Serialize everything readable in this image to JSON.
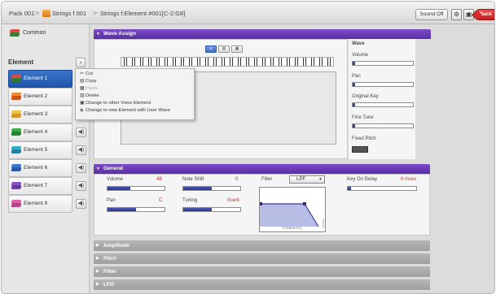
{
  "topbar": {
    "crumbs": [
      "Pack 001",
      "Strings f 001",
      "Strings f:Element #001[C-2:G8]"
    ],
    "separator": ">",
    "sound_off": "Sound Off",
    "back": "Back"
  },
  "sidebar": {
    "common": "Common",
    "element_header": "Element",
    "elements": [
      {
        "label": "Element 1",
        "selected": true,
        "c1": "#e04848",
        "c2": "#2c7a2a"
      },
      {
        "label": "Element 2",
        "c1": "#f08a30",
        "c2": "#c84b0a"
      },
      {
        "label": "Element 3",
        "c1": "#f0c040",
        "c2": "#d09020"
      },
      {
        "label": "Element 4",
        "c1": "#38b048",
        "c2": "#1e7a2a"
      },
      {
        "label": "Element 5",
        "c1": "#30b0c8",
        "c2": "#1b7c98"
      },
      {
        "label": "Element 6",
        "c1": "#3878d0",
        "c2": "#2050a8"
      },
      {
        "label": "Element 7",
        "c1": "#8a50c8",
        "c2": "#6030a0"
      },
      {
        "label": "Element 8",
        "c1": "#e060a8",
        "c2": "#b03a80"
      }
    ]
  },
  "context_menu": {
    "items": [
      {
        "label": "Cut",
        "icon": "✂"
      },
      {
        "label": "Copy",
        "icon": "▤"
      },
      {
        "label": "Paste",
        "icon": "▦",
        "disabled": true
      },
      {
        "label": "Delete",
        "icon": "▥"
      },
      {
        "label": "Change to other Voice Element",
        "icon": "▣"
      },
      {
        "label": "Change to new Element with User Wave",
        "icon": "◈"
      }
    ]
  },
  "wave_assign": {
    "title": "Wave Assign",
    "side": {
      "title": "Wave",
      "volume": "Volume",
      "pan": "Pan",
      "original_key": "Original Key",
      "fine_tune": "Fine Tune",
      "fixed_pitch": "Fixed Pitch"
    }
  },
  "general": {
    "title": "General",
    "volume_label": "Volume",
    "volume_value": "48",
    "pan_label": "Pan",
    "pan_value": "C",
    "note_shift_label": "Note Shift",
    "note_shift_value": "0",
    "tuning_label": "Tuning",
    "tuning_value": "0cent",
    "filter_label": "Filter",
    "filter_value": "LPF",
    "frequency": "Frequency",
    "key_on_delay_label": "Key On Delay",
    "key_on_delay_value": "0 msec"
  },
  "sections": [
    "Amplitude",
    "Pitch",
    "Filter",
    "LFO"
  ],
  "levels": {
    "volume": 0.4,
    "pan": 0.5,
    "note_shift": 0.5,
    "tuning": 0.5,
    "key_on_delay": 0.05
  },
  "colors": {
    "selected": "#1f57b0",
    "section": "#5a2ea6",
    "back": "#c01e1e"
  }
}
